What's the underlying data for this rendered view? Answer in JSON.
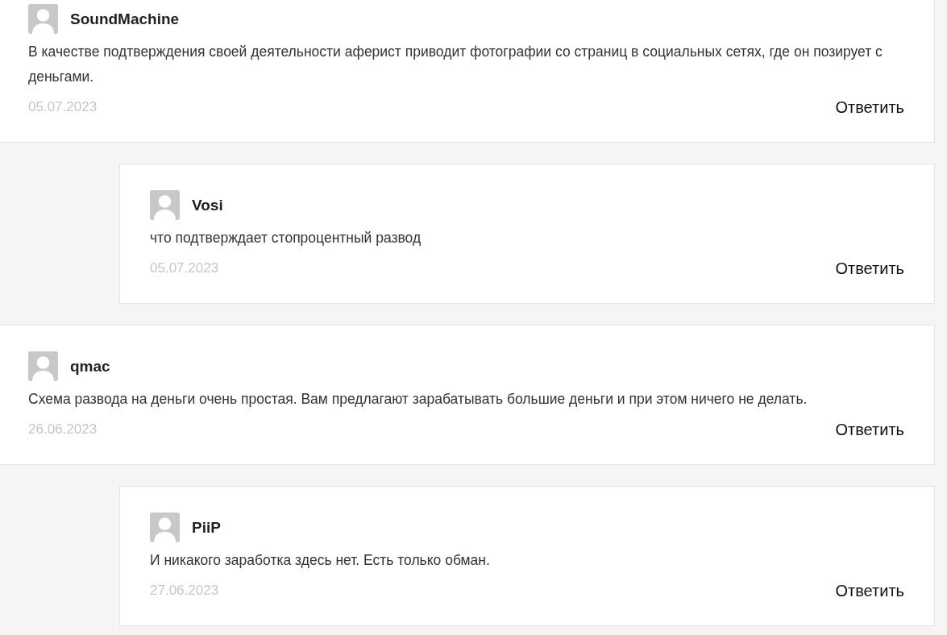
{
  "comments": [
    {
      "author": "SoundMachine",
      "text": "В качестве подтверждения своей деятельности аферист приводит фотографии со страниц в социальных сетях, где он позирует с деньгами.",
      "date": "05.07.2023",
      "reply_label": "Ответить",
      "replies": [
        {
          "author": "Vosi",
          "text": "что подтверждает стопроцентный развод",
          "date": "05.07.2023",
          "reply_label": "Ответить"
        }
      ]
    },
    {
      "author": "qmac",
      "text": "Схема развода на деньги очень простая. Вам предлагают зарабатывать большие деньги и при этом ничего не делать.",
      "date": "26.06.2023",
      "reply_label": "Ответить",
      "replies": [
        {
          "author": "PiiP",
          "text": "И никакого заработка здесь нет. Есть только обман.",
          "date": "27.06.2023",
          "reply_label": "Ответить"
        }
      ]
    }
  ]
}
